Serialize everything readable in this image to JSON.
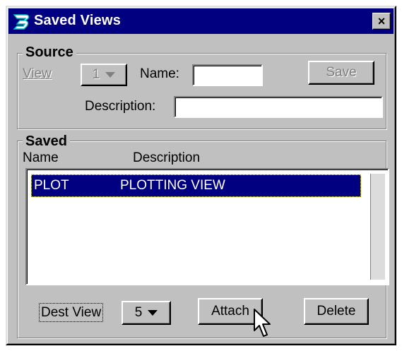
{
  "window": {
    "title": "Saved Views",
    "close_glyph": "×",
    "app_icon": "bentley-b-icon"
  },
  "source": {
    "legend": "Source",
    "view_label": "View",
    "view_value": "1",
    "name_label": "Name:",
    "name_value": "",
    "save_label": "Save",
    "description_label": "Description:",
    "description_value": ""
  },
  "saved": {
    "legend": "Saved",
    "columns": [
      "Name",
      "Description"
    ],
    "rows": [
      {
        "name": "PLOT",
        "description": "PLOTTING VIEW",
        "selected": true
      }
    ]
  },
  "footer": {
    "dest_view_label": "Dest View",
    "dest_view_value": "5",
    "attach_label": "Attach",
    "delete_label": "Delete"
  },
  "colors": {
    "titlebar": "#000080",
    "face": "#c0c0c0",
    "selection": "#000080"
  }
}
